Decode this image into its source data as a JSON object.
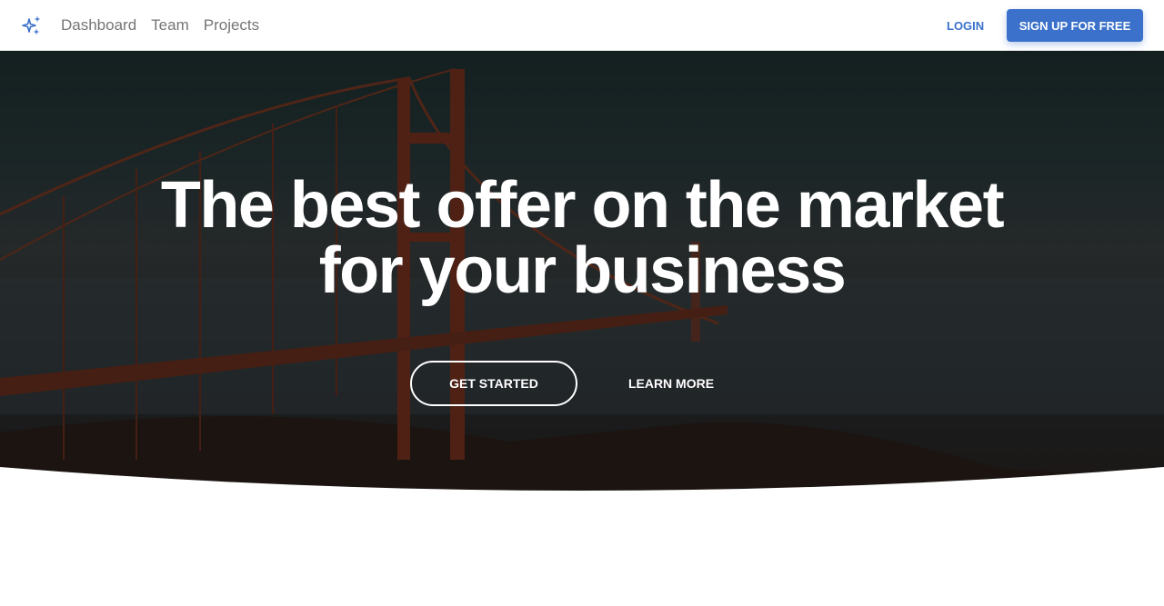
{
  "nav": {
    "links": [
      "Dashboard",
      "Team",
      "Projects"
    ],
    "login": "LOGIN",
    "signup": "SIGN UP FOR FREE",
    "brand_color": "#3b71ca"
  },
  "hero": {
    "title_line1": "The best offer on the market",
    "title_line2": "for your business",
    "get_started": "GET STARTED",
    "learn_more": "LEARN MORE"
  }
}
